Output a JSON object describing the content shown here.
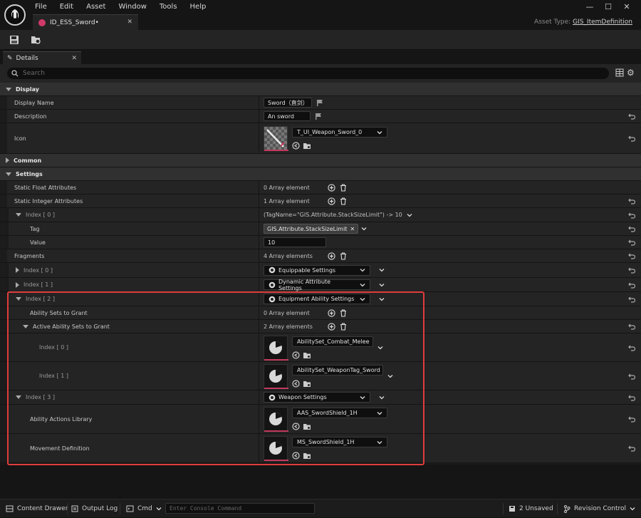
{
  "menu": [
    "File",
    "Edit",
    "Asset",
    "Window",
    "Tools",
    "Help"
  ],
  "document_tab": {
    "title": "ID_ESS_Sword•"
  },
  "asset_type": {
    "label": "Asset Type:",
    "value": "GIS_ItemDefinition"
  },
  "details_tab": {
    "title": "Details"
  },
  "search": {
    "placeholder": "Search"
  },
  "rows": {
    "display": "Display",
    "display_name": {
      "label": "Display Name",
      "value": "Sword（直剑）"
    },
    "description": {
      "label": "Description",
      "value": "An sword"
    },
    "icon": {
      "label": "Icon",
      "value": "T_UI_Weapon_Sword_0"
    },
    "common": "Common",
    "settings": "Settings",
    "static_float": {
      "label": "Static Float Attributes",
      "value": "0 Array element"
    },
    "static_int": {
      "label": "Static Integer Attributes",
      "value": "1 Array element"
    },
    "int_index0": {
      "label": "Index [ 0 ]",
      "value": "(TagName=\"GIS.Attribute.StackSizeLimit\") -> 10"
    },
    "tag": {
      "label": "Tag",
      "value": "GIS.Attribute.StackSizeLimit"
    },
    "value": {
      "label": "Value",
      "value": "10"
    },
    "fragments": {
      "label": "Fragments",
      "value": "4 Array elements"
    },
    "frag0": {
      "label": "Index [ 0 ]",
      "value": "Equippable Settings"
    },
    "frag1": {
      "label": "Index [ 1 ]",
      "value": "Dynamic Attribute Settings"
    },
    "frag2": {
      "label": "Index [ 2 ]",
      "value": "Equipment Ability Settings"
    },
    "ability_sets": {
      "label": "Ability Sets to Grant",
      "value": "0 Array element"
    },
    "active_ability_sets": {
      "label": "Active Ability Sets to Grant",
      "value": "2 Array elements"
    },
    "aas0": {
      "label": "Index [ 0 ]",
      "value": "AbilitySet_Combat_Melee"
    },
    "aas1": {
      "label": "Index [ 1 ]",
      "value": "AbilitySet_WeaponTag_Sword"
    },
    "frag3": {
      "label": "Index [ 3 ]",
      "value": "Weapon Settings"
    },
    "ability_actions": {
      "label": "Ability Actions Library",
      "value": "AAS_SwordShield_1H"
    },
    "movement": {
      "label": "Movement Definition",
      "value": "MS_SwordShield_1H"
    }
  },
  "statusbar": {
    "content_drawer": "Content Drawer",
    "output_log": "Output Log",
    "cmd": "Cmd",
    "console_placeholder": "Enter Console Command",
    "unsaved": "2 Unsaved",
    "revision": "Revision Control"
  },
  "colors": {
    "accent_pink": "#c23a5e",
    "highlight_box": "#e03c3c"
  }
}
